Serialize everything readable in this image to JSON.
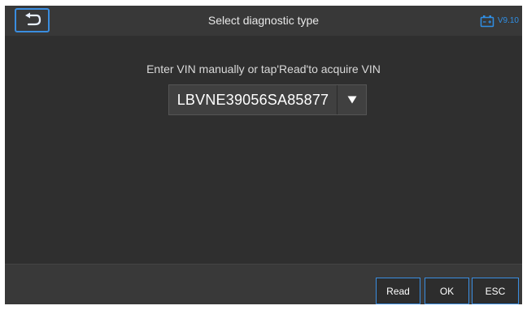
{
  "header": {
    "title": "Select diagnostic type",
    "version": "V9.10",
    "icons": {
      "back": "back-arrow-icon",
      "battery": "battery-icon"
    }
  },
  "main": {
    "prompt": "Enter VIN manually or tap'Read'to acquire VIN",
    "vin_value": "LBVNE39056SA85877",
    "dropdown_icon": "triangle-down-icon"
  },
  "footer": {
    "read_label": "Read",
    "ok_label": "OK",
    "esc_label": "ESC"
  },
  "colors": {
    "accent": "#3a8de0",
    "background": "#2f2f2f",
    "bar": "#383838"
  }
}
